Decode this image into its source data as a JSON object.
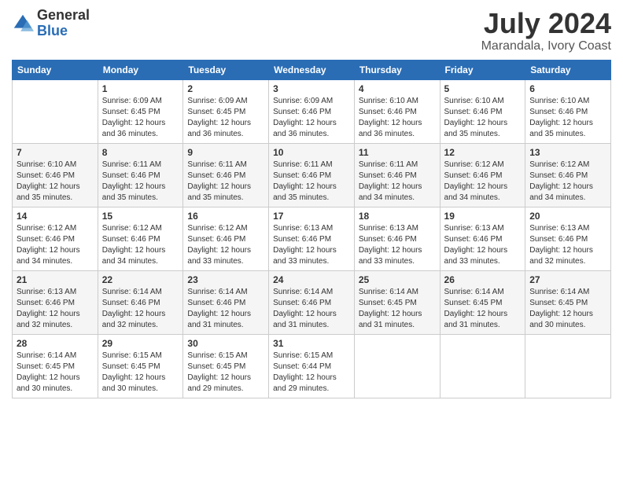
{
  "logo": {
    "general": "General",
    "blue": "Blue"
  },
  "title": {
    "month_year": "July 2024",
    "location": "Marandala, Ivory Coast"
  },
  "weekdays": [
    "Sunday",
    "Monday",
    "Tuesday",
    "Wednesday",
    "Thursday",
    "Friday",
    "Saturday"
  ],
  "weeks": [
    [
      {
        "day": "",
        "info": ""
      },
      {
        "day": "1",
        "info": "Sunrise: 6:09 AM\nSunset: 6:45 PM\nDaylight: 12 hours\nand 36 minutes."
      },
      {
        "day": "2",
        "info": "Sunrise: 6:09 AM\nSunset: 6:45 PM\nDaylight: 12 hours\nand 36 minutes."
      },
      {
        "day": "3",
        "info": "Sunrise: 6:09 AM\nSunset: 6:46 PM\nDaylight: 12 hours\nand 36 minutes."
      },
      {
        "day": "4",
        "info": "Sunrise: 6:10 AM\nSunset: 6:46 PM\nDaylight: 12 hours\nand 36 minutes."
      },
      {
        "day": "5",
        "info": "Sunrise: 6:10 AM\nSunset: 6:46 PM\nDaylight: 12 hours\nand 35 minutes."
      },
      {
        "day": "6",
        "info": "Sunrise: 6:10 AM\nSunset: 6:46 PM\nDaylight: 12 hours\nand 35 minutes."
      }
    ],
    [
      {
        "day": "7",
        "info": "Sunrise: 6:10 AM\nSunset: 6:46 PM\nDaylight: 12 hours\nand 35 minutes."
      },
      {
        "day": "8",
        "info": "Sunrise: 6:11 AM\nSunset: 6:46 PM\nDaylight: 12 hours\nand 35 minutes."
      },
      {
        "day": "9",
        "info": "Sunrise: 6:11 AM\nSunset: 6:46 PM\nDaylight: 12 hours\nand 35 minutes."
      },
      {
        "day": "10",
        "info": "Sunrise: 6:11 AM\nSunset: 6:46 PM\nDaylight: 12 hours\nand 35 minutes."
      },
      {
        "day": "11",
        "info": "Sunrise: 6:11 AM\nSunset: 6:46 PM\nDaylight: 12 hours\nand 34 minutes."
      },
      {
        "day": "12",
        "info": "Sunrise: 6:12 AM\nSunset: 6:46 PM\nDaylight: 12 hours\nand 34 minutes."
      },
      {
        "day": "13",
        "info": "Sunrise: 6:12 AM\nSunset: 6:46 PM\nDaylight: 12 hours\nand 34 minutes."
      }
    ],
    [
      {
        "day": "14",
        "info": "Sunrise: 6:12 AM\nSunset: 6:46 PM\nDaylight: 12 hours\nand 34 minutes."
      },
      {
        "day": "15",
        "info": "Sunrise: 6:12 AM\nSunset: 6:46 PM\nDaylight: 12 hours\nand 34 minutes."
      },
      {
        "day": "16",
        "info": "Sunrise: 6:12 AM\nSunset: 6:46 PM\nDaylight: 12 hours\nand 33 minutes."
      },
      {
        "day": "17",
        "info": "Sunrise: 6:13 AM\nSunset: 6:46 PM\nDaylight: 12 hours\nand 33 minutes."
      },
      {
        "day": "18",
        "info": "Sunrise: 6:13 AM\nSunset: 6:46 PM\nDaylight: 12 hours\nand 33 minutes."
      },
      {
        "day": "19",
        "info": "Sunrise: 6:13 AM\nSunset: 6:46 PM\nDaylight: 12 hours\nand 33 minutes."
      },
      {
        "day": "20",
        "info": "Sunrise: 6:13 AM\nSunset: 6:46 PM\nDaylight: 12 hours\nand 32 minutes."
      }
    ],
    [
      {
        "day": "21",
        "info": "Sunrise: 6:13 AM\nSunset: 6:46 PM\nDaylight: 12 hours\nand 32 minutes."
      },
      {
        "day": "22",
        "info": "Sunrise: 6:14 AM\nSunset: 6:46 PM\nDaylight: 12 hours\nand 32 minutes."
      },
      {
        "day": "23",
        "info": "Sunrise: 6:14 AM\nSunset: 6:46 PM\nDaylight: 12 hours\nand 31 minutes."
      },
      {
        "day": "24",
        "info": "Sunrise: 6:14 AM\nSunset: 6:46 PM\nDaylight: 12 hours\nand 31 minutes."
      },
      {
        "day": "25",
        "info": "Sunrise: 6:14 AM\nSunset: 6:45 PM\nDaylight: 12 hours\nand 31 minutes."
      },
      {
        "day": "26",
        "info": "Sunrise: 6:14 AM\nSunset: 6:45 PM\nDaylight: 12 hours\nand 31 minutes."
      },
      {
        "day": "27",
        "info": "Sunrise: 6:14 AM\nSunset: 6:45 PM\nDaylight: 12 hours\nand 30 minutes."
      }
    ],
    [
      {
        "day": "28",
        "info": "Sunrise: 6:14 AM\nSunset: 6:45 PM\nDaylight: 12 hours\nand 30 minutes."
      },
      {
        "day": "29",
        "info": "Sunrise: 6:15 AM\nSunset: 6:45 PM\nDaylight: 12 hours\nand 30 minutes."
      },
      {
        "day": "30",
        "info": "Sunrise: 6:15 AM\nSunset: 6:45 PM\nDaylight: 12 hours\nand 29 minutes."
      },
      {
        "day": "31",
        "info": "Sunrise: 6:15 AM\nSunset: 6:44 PM\nDaylight: 12 hours\nand 29 minutes."
      },
      {
        "day": "",
        "info": ""
      },
      {
        "day": "",
        "info": ""
      },
      {
        "day": "",
        "info": ""
      }
    ]
  ]
}
